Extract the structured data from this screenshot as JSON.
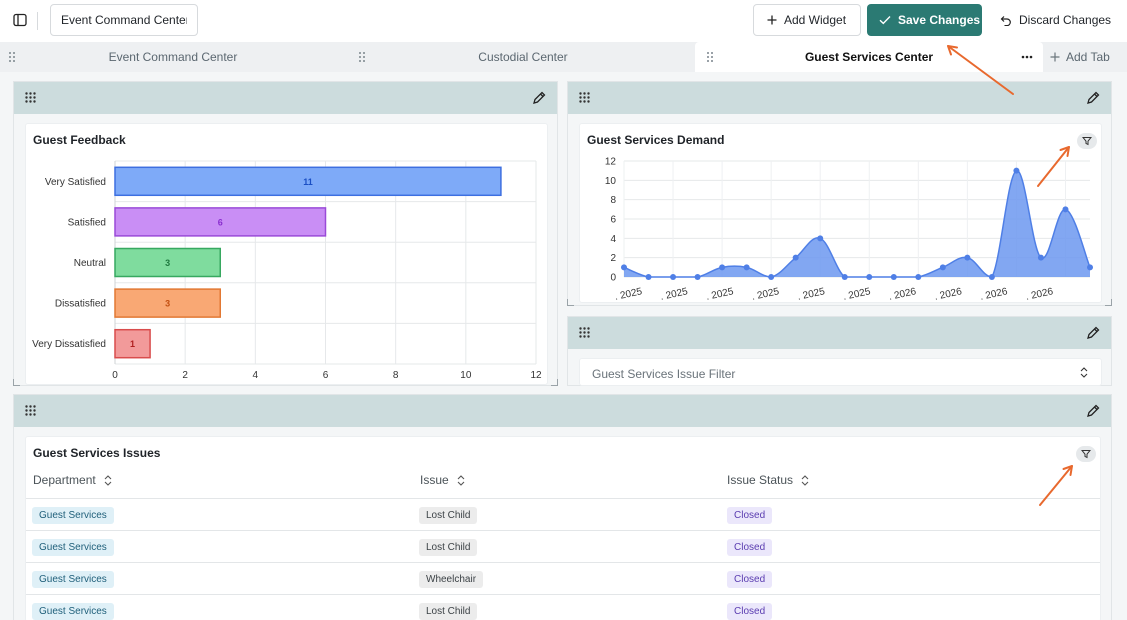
{
  "toolbar": {
    "dashboard_name": "Event Command Center",
    "add_widget_label": "Add Widget",
    "save_label": "Save Changes",
    "discard_label": "Discard Changes"
  },
  "tabs": [
    {
      "label": "Event Command Center",
      "active": false
    },
    {
      "label": "Custodial Center",
      "active": false
    },
    {
      "label": "Guest Services Center",
      "active": true
    }
  ],
  "add_tab_label": "Add Tab",
  "widgets": {
    "guest_feedback": {
      "title": "Guest Feedback"
    },
    "guest_services_demand": {
      "title": "Guest Services Demand"
    },
    "issue_filter": {
      "placeholder": "Guest Services Issue Filter"
    },
    "issues_table": {
      "title": "Guest Services Issues",
      "columns": [
        "Department",
        "Issue",
        "Issue Status"
      ],
      "rows": [
        {
          "department": "Guest Services",
          "issue": "Lost Child",
          "status": "Closed"
        },
        {
          "department": "Guest Services",
          "issue": "Lost Child",
          "status": "Closed"
        },
        {
          "department": "Guest Services",
          "issue": "Wheelchair",
          "status": "Closed"
        },
        {
          "department": "Guest Services",
          "issue": "Lost Child",
          "status": "Closed"
        }
      ]
    }
  },
  "colors": {
    "accent": "#2b7a73",
    "widget_header": "#ccdcdd",
    "annotation_arrow": "#e8692e"
  },
  "chart_data": [
    {
      "type": "bar",
      "orientation": "horizontal",
      "title": "Guest Feedback",
      "categories": [
        "Very Satisfied",
        "Satisfied",
        "Neutral",
        "Dissatisfied",
        "Very Dissatisfied"
      ],
      "values": [
        11,
        6,
        3,
        3,
        1
      ],
      "colors": [
        "#7eaaf8",
        "#c98ef5",
        "#7fdc9e",
        "#f9a874",
        "#f29a9a"
      ],
      "border_colors": [
        "#3d6fe0",
        "#9a4ad8",
        "#37a860",
        "#e27833",
        "#d94c4c"
      ],
      "label_colors": [
        "#1b4fc4",
        "#8a2fcf",
        "#1f7a40",
        "#c24e10",
        "#b02020"
      ],
      "x_ticks": [
        "0",
        "2",
        "4",
        "6",
        "8",
        "10",
        "12"
      ],
      "xlim": [
        0,
        12
      ],
      "grid": true
    },
    {
      "type": "area",
      "title": "Guest Services Demand",
      "y_ticks": [
        "0",
        "2",
        "4",
        "6",
        "8",
        "10",
        "12"
      ],
      "ylim": [
        0,
        12
      ],
      "values": [
        1,
        0,
        0,
        0,
        1,
        1,
        0,
        2,
        4,
        0,
        0,
        0,
        0,
        1,
        2,
        0,
        11,
        2,
        7,
        1
      ],
      "x_tick_labels": [
        ". 2025",
        ". 2025",
        ". 2025",
        ". 2025",
        ". 2025",
        ". 2025",
        ". 2026",
        ". 2026",
        ". 2026",
        ". 2026"
      ],
      "color": "#4f7fe6",
      "fill_color": "#6c98f0",
      "grid": true
    }
  ]
}
